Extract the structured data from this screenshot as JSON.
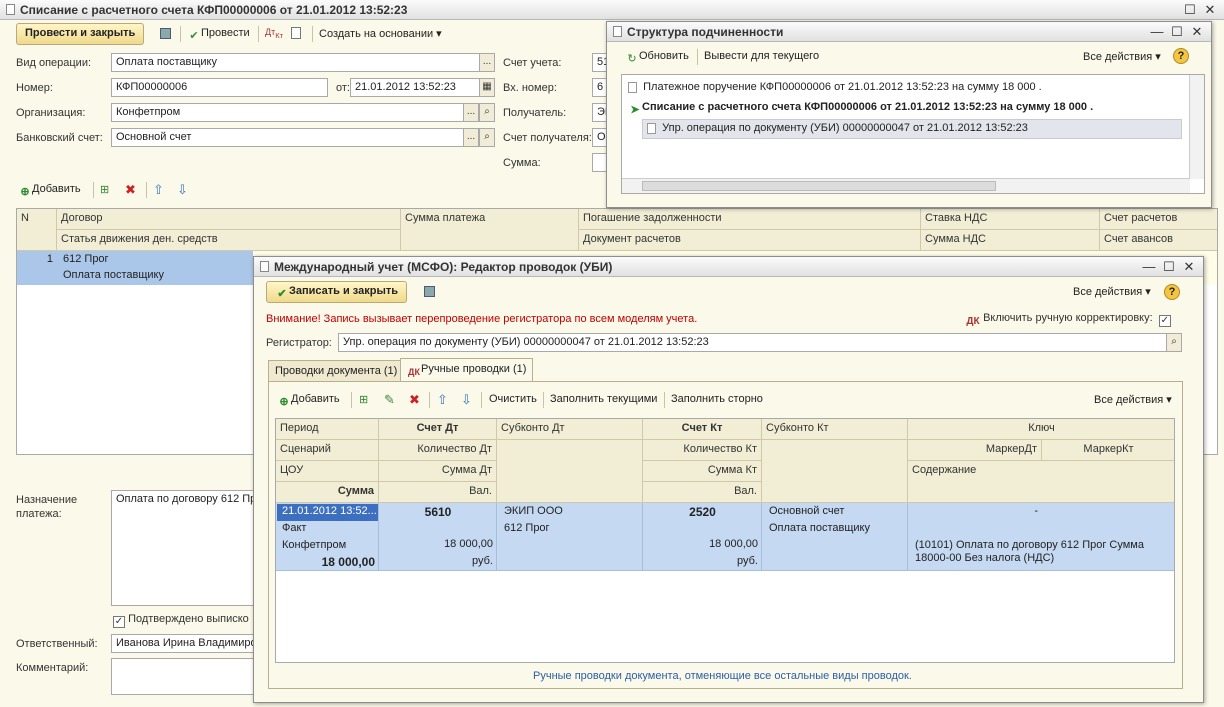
{
  "main_window": {
    "title": "Списание с расчетного счета КФП00000006 от 21.01.2012 13:52:23",
    "toolbar": {
      "post_close": "Провести и закрыть",
      "post": "Провести",
      "create_based": "Создать на основании"
    },
    "fields": {
      "operation_label": "Вид операции:",
      "operation_value": "Оплата поставщику",
      "number_label": "Номер:",
      "number_value": "КФП00000006",
      "date_label": "от:",
      "date_value": "21.01.2012 13:52:23",
      "org_label": "Организация:",
      "org_value": "Конфетпром",
      "bank_label": "Банковский счет:",
      "bank_value": "Основной счет",
      "account_label": "Счет учета:",
      "account_value": "51",
      "in_number_label": "Вх. номер:",
      "in_number_value": "6",
      "recipient_label": "Получатель:",
      "recipient_value": "ЭК",
      "recipient_account_label": "Счет получателя:",
      "recipient_account_value": "Ос",
      "sum_label": "Сумма:"
    },
    "table_toolbar": {
      "add": "Добавить"
    },
    "table": {
      "headers_row1": [
        "N",
        "Договор",
        "Сумма платежа",
        "Погашение задолженности",
        "Ставка НДС",
        "Счет расчетов"
      ],
      "headers_row2": [
        "Статья движения ден. средств",
        "Документ расчетов",
        "Сумма НДС",
        "Счет авансов"
      ],
      "row": {
        "n": "1",
        "contract": "612 Прог",
        "item": "Оплата поставщику"
      }
    },
    "purpose_label": "Назначение платежа:",
    "purpose_value": "Оплата по договору 612 Пр",
    "confirmed_label": "Подтверждено выписко",
    "responsible_label": "Ответственный:",
    "responsible_value": "Иванова Ирина Владимиро",
    "comment_label": "Комментарий:"
  },
  "structure_window": {
    "title": "Структура подчиненности",
    "refresh": "Обновить",
    "show_current": "Вывести для текущего",
    "all_actions": "Все действия",
    "items": [
      "Платежное поручение КФП00000006 от 21.01.2012 13:52:23 на сумму 18 000 .",
      "Списание с расчетного счета КФП00000006 от 21.01.2012 13:52:23 на сумму 18 000 .",
      "Упр. операция по документу (УБИ) 00000000047 от 21.01.2012 13:52:23"
    ]
  },
  "editor_window": {
    "title": "Международный учет (МСФО): Редактор проводок (УБИ)",
    "save_close": "Записать и закрыть",
    "all_actions": "Все действия",
    "warning": "Внимание! Запись вызывает перепроведение регистратора по всем моделям учета.",
    "manual_correction": "Включить ручную корректировку:",
    "registrar_label": "Регистратор:",
    "registrar_value": "Упр. операция по документу (УБИ) 00000000047 от 21.01.2012 13:52:23",
    "tabs": [
      "Проводки документа (1)",
      "Ручные проводки (1)"
    ],
    "toolbar": {
      "add": "Добавить",
      "clear": "Очистить",
      "fill_current": "Заполнить текущими",
      "fill_storno": "Заполнить сторно",
      "all_actions": "Все действия"
    },
    "headers": {
      "period": "Период",
      "scenario": "Сценарий",
      "cou": "ЦОУ",
      "sum": "Сумма",
      "acc_dt": "Счет Дт",
      "qty_dt": "Количество Дт",
      "sum_dt": "Сумма Дт",
      "val": "Вал.",
      "sub_dt": "Субконто Дт",
      "acc_kt": "Счет Кт",
      "qty_kt": "Количество Кт",
      "sum_kt": "Сумма Кт",
      "val_kt": "Вал.",
      "sub_kt": "Субконто Кт",
      "key": "Ключ",
      "marker_dt": "МаркерДт",
      "marker_kt": "МаркерКт",
      "content": "Содержание"
    },
    "row": {
      "period": "21.01.2012 13:52...",
      "scenario": "Факт",
      "cou": "Конфетпром",
      "sum": "18 000,00",
      "acc_dt": "5610",
      "sum_dt": "18 000,00",
      "cur_dt": "руб.",
      "sub_dt1": "ЭКИП ООО",
      "sub_dt2": "612 Прог",
      "acc_kt": "2520",
      "sum_kt": "18 000,00",
      "cur_kt": "руб.",
      "sub_kt1": "Основной счет",
      "sub_kt2": "Оплата поставщику",
      "key": "-",
      "content": "(10101) Оплата по договору 612 Прог Сумма 18000-00 Без налога (НДС)"
    },
    "footer": "Ручные проводки документа, отменяющие все остальные виды проводок."
  }
}
